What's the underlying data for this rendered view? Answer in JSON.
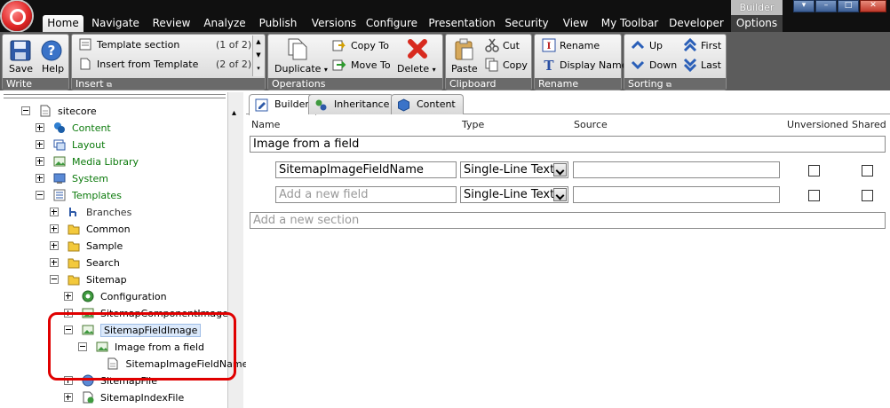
{
  "menu": {
    "tabs": [
      "Home",
      "Navigate",
      "Review",
      "Analyze",
      "Publish",
      "Versions",
      "Configure",
      "Presentation",
      "Security",
      "View",
      "My Toolbar",
      "Developer"
    ],
    "context_header": "Builder",
    "context_tab": "Options"
  },
  "ribbon": {
    "write": {
      "save": "Save",
      "help": "Help",
      "label": "Write"
    },
    "insert": {
      "item1": "Template section",
      "item1_count": "(1 of 2)",
      "item2": "Insert from Template",
      "item2_count": "(2 of 2)",
      "label": "Insert"
    },
    "operations": {
      "duplicate": "Duplicate",
      "copy_to": "Copy To",
      "move_to": "Move To",
      "delete": "Delete",
      "label": "Operations"
    },
    "clipboard": {
      "paste": "Paste",
      "cut": "Cut",
      "copy": "Copy",
      "label": "Clipboard"
    },
    "rename": {
      "rename": "Rename",
      "display_name": "Display Name",
      "label": "Rename"
    },
    "sorting": {
      "up": "Up",
      "first": "First",
      "down": "Down",
      "last": "Last",
      "label": "Sorting"
    }
  },
  "tree": {
    "items": [
      {
        "label": "sitecore"
      },
      {
        "label": "Content"
      },
      {
        "label": "Layout"
      },
      {
        "label": "Media Library"
      },
      {
        "label": "System"
      },
      {
        "label": "Templates"
      },
      {
        "label": "Branches"
      },
      {
        "label": "Common"
      },
      {
        "label": "Sample"
      },
      {
        "label": "Search"
      },
      {
        "label": "Sitemap"
      },
      {
        "label": "Configuration"
      },
      {
        "label": "SitemapComponentImage"
      },
      {
        "label": "SitemapFieldImage"
      },
      {
        "label": "Image from a field"
      },
      {
        "label": "SitemapImageFieldName"
      },
      {
        "label": "SitemapFile"
      },
      {
        "label": "SitemapIndexFile"
      }
    ]
  },
  "editor": {
    "tabs": [
      "Builder",
      "Inheritance",
      "Content"
    ],
    "columns": {
      "name": "Name",
      "type": "Type",
      "source": "Source",
      "unversioned": "Unversioned",
      "shared": "Shared"
    },
    "section_name": "Image from a field",
    "field": {
      "name": "SitemapImageFieldName",
      "type": "Single-Line Text",
      "source": ""
    },
    "new_field": {
      "placeholder": "Add a new field",
      "type": "Single-Line Text"
    },
    "new_section_placeholder": "Add a new section"
  }
}
